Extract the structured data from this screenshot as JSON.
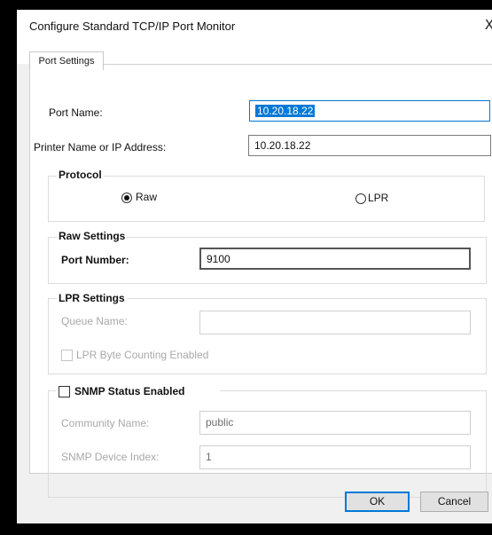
{
  "window": {
    "title": "Configure Standard TCP/IP Port Monitor",
    "close_glyph": "X"
  },
  "tabs": [
    {
      "label": "Port Settings",
      "selected": true
    }
  ],
  "port_name": {
    "label": "Port Name:",
    "value": "10.20.18.22"
  },
  "printer_address": {
    "label": "Printer Name or IP Address:",
    "value": "10.20.18.22"
  },
  "protocol": {
    "title": "Protocol",
    "options": [
      {
        "label": "Raw",
        "checked": true
      },
      {
        "label": "LPR",
        "checked": false
      }
    ]
  },
  "raw_settings": {
    "title": "Raw Settings",
    "port_number_label": "Port Number:",
    "port_number_value": "9100"
  },
  "lpr_settings": {
    "title": "LPR Settings",
    "queue_name_label": "Queue Name:",
    "queue_name_value": "",
    "byte_counting_label": "LPR Byte Counting Enabled",
    "byte_counting_checked": false
  },
  "snmp": {
    "title": "SNMP Status Enabled",
    "checked": false,
    "community_name_label": "Community Name:",
    "community_name_value": "public",
    "device_index_label": "SNMP Device Index:",
    "device_index_value": "1"
  },
  "buttons": {
    "ok": "OK",
    "cancel": "Cancel"
  },
  "colors": {
    "accent": "#0078d7",
    "dialog_background": "#f0f0f0",
    "disabled_text": "#a8a8a8"
  }
}
